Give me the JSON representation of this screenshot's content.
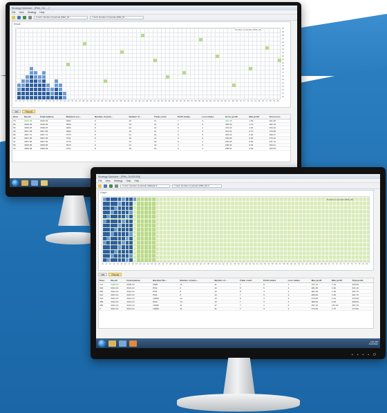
{
  "back_window": {
    "title": "Strategy Optimizer - [PMk_OU_...]",
    "menu": [
      "File",
      "View",
      "Strategy",
      "Help"
    ],
    "toolbar_selects": [
      "X-Axis: Number of periods (SMA_ID ...",
      "Y-Axis: Number of periods (PMk_ID ..."
    ],
    "chart_label": "Result",
    "legend_note": "Number of periods (PMk_ID)",
    "y_ticks": [
      "30",
      "29",
      "28",
      "27",
      "26",
      "25",
      "24",
      "23",
      "22",
      "21",
      "20",
      "19",
      "18",
      "17",
      "16",
      "15",
      "14",
      "13",
      "12",
      "11",
      "10"
    ],
    "x_ticks": [
      "10",
      "11",
      "12",
      "13",
      "14",
      "15",
      "16",
      "17",
      "18",
      "19",
      "20",
      "21",
      "22",
      "23",
      "24",
      "25",
      "26",
      "27",
      "28",
      "29",
      "30",
      "31",
      "32",
      "33",
      "34",
      "35",
      "36",
      "37",
      "38",
      "39",
      "40",
      "41",
      "42",
      "43",
      "44",
      "45",
      "46",
      "47",
      "48",
      "49",
      "50",
      "51",
      "52",
      "53",
      "54",
      "55",
      "56",
      "57",
      "58",
      "59",
      "60",
      "61",
      "62",
      "63",
      "64",
      "65",
      "66",
      "67",
      "68",
      "69",
      "70",
      "71",
      "72",
      "73",
      "74",
      "75",
      "76",
      "77",
      "78",
      "79",
      "80"
    ],
    "tabs": [
      "Job",
      "Results"
    ],
    "columns": [
      "Pass",
      "Result",
      "Final balance",
      "Backtest sco...",
      "Number of perio...",
      "Number of ...",
      "Trade count",
      "Profit trades",
      "Loss trades",
      "Gross profit",
      "Max profit",
      "Gross loss"
    ],
    "rows": [
      [
        "75",
        "3310.33",
        "3310.33",
        "4993",
        "9",
        "16",
        "11",
        "7",
        "4",
        "342.45",
        "1.99",
        "181.95"
      ],
      [
        "80",
        "3310.29",
        "3310.29",
        "3993",
        "9",
        "16",
        "11",
        "6",
        "5",
        "345.00",
        "1.70",
        "182.14"
      ],
      [
        "50",
        "3308.25",
        "3308.25",
        "3956",
        "8",
        "22",
        "10",
        "6",
        "4",
        "372.33",
        "1.90",
        "200.22"
      ],
      [
        "45",
        "3307.95",
        "3307.95",
        "3992",
        "9",
        "16",
        "11",
        "7",
        "4",
        "341.61",
        "0.70",
        "176.99"
      ],
      [
        "80",
        "3307.71",
        "3307.71",
        "3776",
        "8",
        "21",
        "10",
        "5",
        "5",
        "315.23",
        "0.90",
        "189.47"
      ],
      [
        "65",
        "3307.25",
        "3307.25",
        "3761",
        "8",
        "16",
        "12",
        "6",
        "6",
        "330.83",
        "0.90",
        "176.22"
      ],
      [
        "31",
        "3307.00",
        "3307.00",
        "3776",
        "7",
        "14",
        "10",
        "6",
        "4",
        "281.60",
        "0.92",
        "221.14"
      ],
      [
        "80",
        "3306.96",
        "3306.96",
        "3970",
        "9",
        "21",
        "10",
        "7",
        "3",
        "289.40",
        "0.92",
        "159.41"
      ],
      [
        "44",
        "3306.48",
        "3306.48",
        "3767",
        "8",
        "19",
        "10",
        "6",
        "4",
        "285.51",
        "0.92",
        "160.54"
      ]
    ],
    "taskbar_clock": [
      "14:11",
      "1/1/2012"
    ]
  },
  "front_window": {
    "title": "Strategy Optimizer - [PMk_OU/DDSM]",
    "menu": [
      "File",
      "View",
      "Strategy",
      "Help",
      "Help"
    ],
    "toolbar_selects": [
      "X-Axis: Number of periods (SMA(2)) ▾",
      "Y-Axis: Number of periods (PMk_ID) ▾"
    ],
    "chart_label": "Graph",
    "legend_note": "Number of periods (PMk_ID)",
    "x_ticks": [
      "10",
      "11",
      "12",
      "13",
      "14",
      "15",
      "16",
      "17",
      "18",
      "19",
      "20",
      "21",
      "22",
      "23",
      "24",
      "25",
      "26",
      "27",
      "28",
      "29",
      "30",
      "31",
      "32",
      "33",
      "34",
      "35",
      "36",
      "37",
      "38",
      "39",
      "40",
      "41",
      "42",
      "43",
      "44",
      "45",
      "46",
      "47",
      "48",
      "49",
      "50",
      "51",
      "52",
      "53",
      "54",
      "55",
      "56",
      "57",
      "58",
      "59",
      "60",
      "61",
      "62",
      "63",
      "64",
      "65",
      "66",
      "67",
      "68",
      "69",
      "70",
      "71",
      "72",
      "73",
      "74",
      "75",
      "76",
      "77",
      "78",
      "79",
      "80"
    ],
    "tabs": [
      "Job",
      "Results"
    ],
    "columns": [
      "Pass",
      "Result",
      "Final balance",
      "Backtest Re...",
      "Number of perio...",
      "Number of ...",
      "Trade count",
      "Profit trades",
      "Loss trades",
      "Max profit",
      "Max profit",
      "Total profit"
    ],
    "rows": [
      [
        "171",
        "3335.10",
        "3335.10",
        "2995",
        "11",
        "11",
        "7",
        "6",
        "1",
        "385.20",
        "1.70",
        "333.60"
      ],
      [
        "304",
        "3321.10",
        "3321.10",
        "PMk",
        "2",
        "13",
        "6",
        "5",
        "1",
        "281.30",
        "1.90",
        "321.10"
      ],
      [
        "282",
        "3321.10",
        "3321.10",
        "PMk",
        "8",
        "13",
        "8",
        "4",
        "4",
        "281.30",
        "1.90",
        "291.70"
      ],
      [
        "314",
        "3321.10",
        "3321.10",
        "PMk",
        "8",
        "14",
        "7",
        "5",
        "2",
        "280.00",
        "1.90",
        "291.70"
      ],
      [
        "301",
        "3321.10",
        "3321.10",
        "10990",
        "12",
        "13",
        "6",
        "4",
        "2",
        "270.00",
        "1.91",
        "270.00"
      ],
      [
        "485",
        "3321.10",
        "3321.10",
        "PMk",
        "13",
        "13",
        "7",
        "3",
        "4",
        "285.00",
        "2.00",
        "259.83"
      ],
      [
        "459",
        "3321.10",
        "3321.10",
        "10990",
        "11",
        "17",
        "7",
        "1",
        "6",
        "287.10",
        "187.20",
        "287.10"
      ],
      [
        "2",
        "3321.10",
        "3321.10",
        "10990",
        "11",
        "11",
        "7",
        "3",
        "4",
        "273.00",
        "1.70",
        "273.00"
      ]
    ],
    "taskbar_clock": [
      "4:21 PM",
      "4/13/2012"
    ]
  },
  "colors": {
    "blue_bar": "#2f5f9e",
    "blue_light": "#6e9bd0",
    "green_cell": "#b9d989",
    "green_pale": "#d8eab8",
    "selection": "#f9e7a5",
    "accent_text": "#2a9d2a"
  }
}
